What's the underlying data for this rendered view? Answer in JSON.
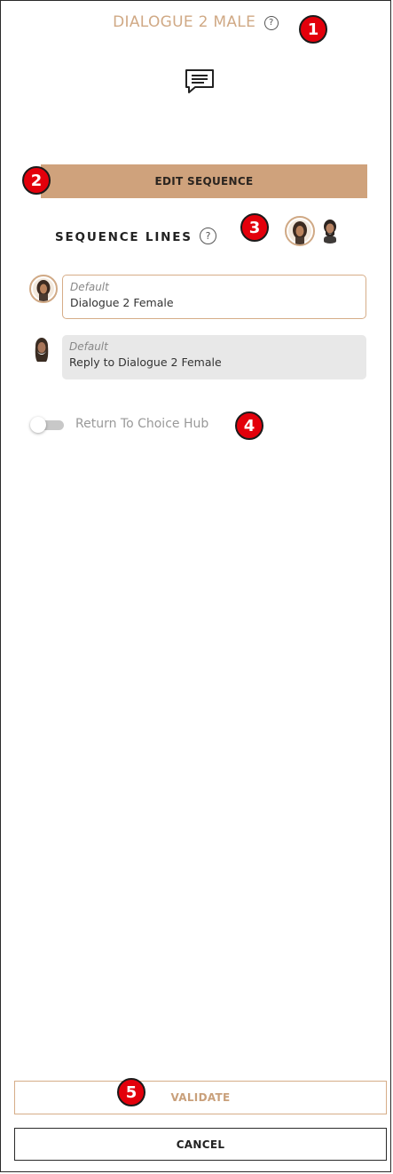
{
  "header": {
    "title": "DIALOGUE 2 MALE",
    "help_glyph": "?",
    "icon": "speech-bubble-icon"
  },
  "markers": [
    "1",
    "2",
    "3",
    "4",
    "5"
  ],
  "actions": {
    "edit_sequence": "EDIT SEQUENCE",
    "validate": "VALIDATE",
    "cancel": "CANCEL"
  },
  "sequence": {
    "title": "SEQUENCE LINES",
    "help_glyph": "?",
    "lines": [
      {
        "type": "Default",
        "text": "Dialogue 2 Female",
        "speaker": "female-avatar",
        "state": "selected"
      },
      {
        "type": "Default",
        "text": "Reply to Dialogue 2 Female",
        "speaker": "male-avatar",
        "state": "unselected"
      }
    ]
  },
  "return_hub": {
    "label": "Return To Choice Hub",
    "checked": false
  },
  "colors": {
    "accent": "#cfa27c",
    "title": "#d0a985",
    "marker": "#e3000b",
    "inactive_bg": "#e8e8e8"
  }
}
